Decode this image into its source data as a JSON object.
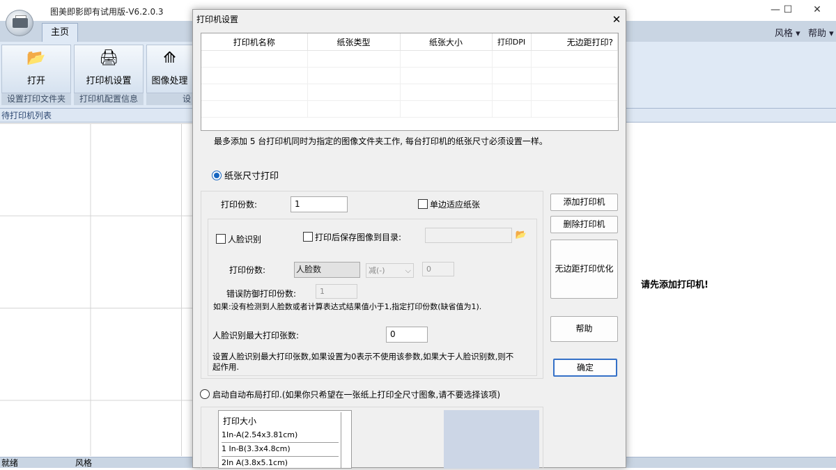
{
  "app": {
    "title": "图美即影即有试用版-V6.2.0.3",
    "window_controls": [
      "—",
      "☐",
      "✕"
    ],
    "tab_home": "主页",
    "menu_style": "风格",
    "menu_help": "帮助",
    "ribbon_buttons": [
      {
        "label": "打开",
        "icon": "folder-icon"
      },
      {
        "label": "打印机设置",
        "icon": "printer-icon"
      },
      {
        "label": "图像处理",
        "icon": "image-process-icon"
      }
    ],
    "ribbon_groups": [
      "设置打印文件夹",
      "打印机配置信息",
      "设"
    ],
    "list_header": "待打印机列表",
    "right_message": "请先添加打印机!",
    "status_left": "就绪",
    "status_style": "风格"
  },
  "dialog": {
    "title": "打印机设置",
    "close": "✕",
    "table_headers": [
      "打印机名称",
      "纸张类型",
      "纸张大小",
      "打印DPI",
      "无边距打印?"
    ],
    "note": "最多添加 5 台打印机同时为指定的图像文件夹工作, 每台打印机的纸张尺寸必须设置一样。",
    "radio_paper_size": "纸张尺寸打印",
    "copies_label": "打印份数:",
    "copies_value": "1",
    "fit_one_side": "单边适应纸张",
    "face_recognition": "人脸识别",
    "save_after_print": "打印后保存图像到目录:",
    "face_copies_label": "打印份数:",
    "face_count_value": "人脸数",
    "operator_value": "减(-)",
    "operand_value": "0",
    "fallback_label": "错误防御打印份数:",
    "fallback_value": "1",
    "fallback_note": "如果:没有检测到人脸数或者计算表达式结果值小于1,指定打印份数(缺省值为1).",
    "max_face_label": "人脸识别最大打印张数:",
    "max_face_value": "0",
    "max_face_note_1": "设置人脸识别最大打印张数,如果设置为0表示不使用该参数,如果大于人脸识别数,则不",
    "max_face_note_2": "起作用.",
    "radio_auto_layout": "启动自动布局打印.(如果你只希望在一张纸上打印全尺寸图象,请不要选择该项)",
    "size_list_header": "打印大小",
    "size_items": [
      "1In-A(2.54x3.81cm)",
      "1 In-B(3.3x4.8cm)",
      "2In A(3.8x5.1cm)"
    ],
    "btn_add": "添加打印机",
    "btn_delete": "删除打印机",
    "btn_borderless": "无边距打印优化",
    "btn_help": "帮助",
    "btn_ok": "确定"
  },
  "colors": {
    "ribbon_bg": "#dfe9f5",
    "accent": "#3470c7",
    "preview": "#ccd6e6"
  }
}
